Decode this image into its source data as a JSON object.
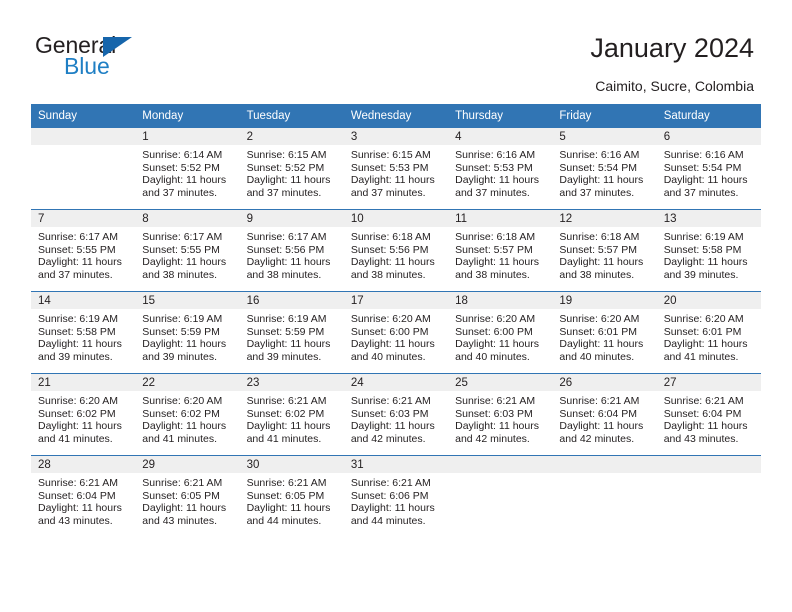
{
  "brand": {
    "word_one": "General",
    "word_two": "Blue",
    "triangle_icon": "triangle-logo-icon",
    "accent_color": "#1f7fc4",
    "triangle_color": "#1665ab"
  },
  "header": {
    "title": "January 2024",
    "location": "Caimito, Sucre, Colombia"
  },
  "calendar": {
    "header_color": "#3175b4",
    "band_color": "#efefef",
    "weekdays": [
      "Sunday",
      "Monday",
      "Tuesday",
      "Wednesday",
      "Thursday",
      "Friday",
      "Saturday"
    ],
    "labels": {
      "sunrise": "Sunrise:",
      "sunset": "Sunset:",
      "daylight": "Daylight:"
    },
    "weeks": [
      [
        {
          "day": "",
          "sunrise": "",
          "sunset": "",
          "daylight": "",
          "empty": true
        },
        {
          "day": "1",
          "sunrise": "Sunrise: 6:14 AM",
          "sunset": "Sunset: 5:52 PM",
          "daylight": "Daylight: 11 hours and 37 minutes."
        },
        {
          "day": "2",
          "sunrise": "Sunrise: 6:15 AM",
          "sunset": "Sunset: 5:52 PM",
          "daylight": "Daylight: 11 hours and 37 minutes."
        },
        {
          "day": "3",
          "sunrise": "Sunrise: 6:15 AM",
          "sunset": "Sunset: 5:53 PM",
          "daylight": "Daylight: 11 hours and 37 minutes."
        },
        {
          "day": "4",
          "sunrise": "Sunrise: 6:16 AM",
          "sunset": "Sunset: 5:53 PM",
          "daylight": "Daylight: 11 hours and 37 minutes."
        },
        {
          "day": "5",
          "sunrise": "Sunrise: 6:16 AM",
          "sunset": "Sunset: 5:54 PM",
          "daylight": "Daylight: 11 hours and 37 minutes."
        },
        {
          "day": "6",
          "sunrise": "Sunrise: 6:16 AM",
          "sunset": "Sunset: 5:54 PM",
          "daylight": "Daylight: 11 hours and 37 minutes."
        }
      ],
      [
        {
          "day": "7",
          "sunrise": "Sunrise: 6:17 AM",
          "sunset": "Sunset: 5:55 PM",
          "daylight": "Daylight: 11 hours and 37 minutes."
        },
        {
          "day": "8",
          "sunrise": "Sunrise: 6:17 AM",
          "sunset": "Sunset: 5:55 PM",
          "daylight": "Daylight: 11 hours and 38 minutes."
        },
        {
          "day": "9",
          "sunrise": "Sunrise: 6:17 AM",
          "sunset": "Sunset: 5:56 PM",
          "daylight": "Daylight: 11 hours and 38 minutes."
        },
        {
          "day": "10",
          "sunrise": "Sunrise: 6:18 AM",
          "sunset": "Sunset: 5:56 PM",
          "daylight": "Daylight: 11 hours and 38 minutes."
        },
        {
          "day": "11",
          "sunrise": "Sunrise: 6:18 AM",
          "sunset": "Sunset: 5:57 PM",
          "daylight": "Daylight: 11 hours and 38 minutes."
        },
        {
          "day": "12",
          "sunrise": "Sunrise: 6:18 AM",
          "sunset": "Sunset: 5:57 PM",
          "daylight": "Daylight: 11 hours and 38 minutes."
        },
        {
          "day": "13",
          "sunrise": "Sunrise: 6:19 AM",
          "sunset": "Sunset: 5:58 PM",
          "daylight": "Daylight: 11 hours and 39 minutes."
        }
      ],
      [
        {
          "day": "14",
          "sunrise": "Sunrise: 6:19 AM",
          "sunset": "Sunset: 5:58 PM",
          "daylight": "Daylight: 11 hours and 39 minutes."
        },
        {
          "day": "15",
          "sunrise": "Sunrise: 6:19 AM",
          "sunset": "Sunset: 5:59 PM",
          "daylight": "Daylight: 11 hours and 39 minutes."
        },
        {
          "day": "16",
          "sunrise": "Sunrise: 6:19 AM",
          "sunset": "Sunset: 5:59 PM",
          "daylight": "Daylight: 11 hours and 39 minutes."
        },
        {
          "day": "17",
          "sunrise": "Sunrise: 6:20 AM",
          "sunset": "Sunset: 6:00 PM",
          "daylight": "Daylight: 11 hours and 40 minutes."
        },
        {
          "day": "18",
          "sunrise": "Sunrise: 6:20 AM",
          "sunset": "Sunset: 6:00 PM",
          "daylight": "Daylight: 11 hours and 40 minutes."
        },
        {
          "day": "19",
          "sunrise": "Sunrise: 6:20 AM",
          "sunset": "Sunset: 6:01 PM",
          "daylight": "Daylight: 11 hours and 40 minutes."
        },
        {
          "day": "20",
          "sunrise": "Sunrise: 6:20 AM",
          "sunset": "Sunset: 6:01 PM",
          "daylight": "Daylight: 11 hours and 41 minutes."
        }
      ],
      [
        {
          "day": "21",
          "sunrise": "Sunrise: 6:20 AM",
          "sunset": "Sunset: 6:02 PM",
          "daylight": "Daylight: 11 hours and 41 minutes."
        },
        {
          "day": "22",
          "sunrise": "Sunrise: 6:20 AM",
          "sunset": "Sunset: 6:02 PM",
          "daylight": "Daylight: 11 hours and 41 minutes."
        },
        {
          "day": "23",
          "sunrise": "Sunrise: 6:21 AM",
          "sunset": "Sunset: 6:02 PM",
          "daylight": "Daylight: 11 hours and 41 minutes."
        },
        {
          "day": "24",
          "sunrise": "Sunrise: 6:21 AM",
          "sunset": "Sunset: 6:03 PM",
          "daylight": "Daylight: 11 hours and 42 minutes."
        },
        {
          "day": "25",
          "sunrise": "Sunrise: 6:21 AM",
          "sunset": "Sunset: 6:03 PM",
          "daylight": "Daylight: 11 hours and 42 minutes."
        },
        {
          "day": "26",
          "sunrise": "Sunrise: 6:21 AM",
          "sunset": "Sunset: 6:04 PM",
          "daylight": "Daylight: 11 hours and 42 minutes."
        },
        {
          "day": "27",
          "sunrise": "Sunrise: 6:21 AM",
          "sunset": "Sunset: 6:04 PM",
          "daylight": "Daylight: 11 hours and 43 minutes."
        }
      ],
      [
        {
          "day": "28",
          "sunrise": "Sunrise: 6:21 AM",
          "sunset": "Sunset: 6:04 PM",
          "daylight": "Daylight: 11 hours and 43 minutes."
        },
        {
          "day": "29",
          "sunrise": "Sunrise: 6:21 AM",
          "sunset": "Sunset: 6:05 PM",
          "daylight": "Daylight: 11 hours and 43 minutes."
        },
        {
          "day": "30",
          "sunrise": "Sunrise: 6:21 AM",
          "sunset": "Sunset: 6:05 PM",
          "daylight": "Daylight: 11 hours and 44 minutes."
        },
        {
          "day": "31",
          "sunrise": "Sunrise: 6:21 AM",
          "sunset": "Sunset: 6:06 PM",
          "daylight": "Daylight: 11 hours and 44 minutes."
        },
        {
          "day": "",
          "sunrise": "",
          "sunset": "",
          "daylight": "",
          "empty": true
        },
        {
          "day": "",
          "sunrise": "",
          "sunset": "",
          "daylight": "",
          "empty": true
        },
        {
          "day": "",
          "sunrise": "",
          "sunset": "",
          "daylight": "",
          "empty": true
        }
      ]
    ]
  }
}
